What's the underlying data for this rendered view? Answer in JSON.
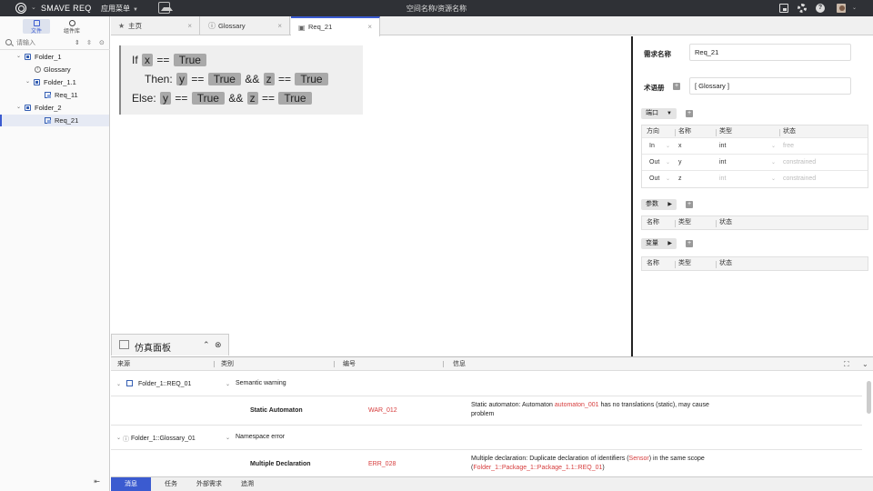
{
  "topbar": {
    "brand": "SMAVE REQ",
    "menu_label": "应用菜单",
    "workspace_path": "空间名称/资源名称"
  },
  "sidebar": {
    "tabs": [
      {
        "label": "文件",
        "active": true
      },
      {
        "label": "组件库",
        "active": false
      }
    ],
    "search_placeholder": "请输入",
    "tree": [
      {
        "label": "Folder_1",
        "type": "folder",
        "expanded": true
      },
      {
        "label": "Glossary",
        "type": "glossary"
      },
      {
        "label": "Folder_1.1",
        "type": "folder",
        "expanded": true
      },
      {
        "label": "Req_11",
        "type": "requirement"
      },
      {
        "label": "Folder_2",
        "type": "folder",
        "expanded": true
      },
      {
        "label": "Req_21",
        "type": "requirement",
        "selected": true
      }
    ],
    "footer_icon": "collapse-icon"
  },
  "tabs": [
    {
      "label": "主页",
      "icon": "star-icon",
      "active": false
    },
    {
      "label": "Glossary",
      "icon": "info-icon",
      "active": false
    },
    {
      "label": "Req_21",
      "icon": "requirement-icon",
      "active": true
    }
  ],
  "editor": {
    "line1": {
      "kw": "If",
      "var": "x",
      "op": "==",
      "val": "True"
    },
    "line2": {
      "kw": "Then:",
      "var1": "y",
      "op1": "==",
      "val1": "True",
      "and": "&&",
      "var2": "z",
      "op2": "==",
      "val2": "True"
    },
    "line3": {
      "kw": "Else:",
      "var1": "y",
      "op1": "==",
      "val1": "True",
      "and": "&&",
      "var2": "z",
      "op2": "==",
      "val2": "True"
    }
  },
  "props": {
    "name_label": "需求名称",
    "name_value": "Req_21",
    "glossary_label": "术语册",
    "glossary_value": "[ Glossary ]",
    "ports_btn": "端口",
    "ports_headers": [
      "方向",
      "名称",
      "类型",
      "状态"
    ],
    "ports_rows": [
      {
        "dir": "In",
        "name": "x",
        "type": "int",
        "status": "free"
      },
      {
        "dir": "Out",
        "name": "y",
        "type": "int",
        "status": "constrained"
      },
      {
        "dir": "Out",
        "name": "z",
        "type": "int",
        "status": "constrained"
      }
    ],
    "params_btn": "参数",
    "params_headers": [
      "名称",
      "类型",
      "状态"
    ],
    "vars_btn": "变量",
    "vars_headers": [
      "名称",
      "类型",
      "状态"
    ]
  },
  "sim_panel": {
    "title": "仿真面板"
  },
  "messages": {
    "headers": [
      "来源",
      "类别",
      "编号",
      "信息"
    ],
    "groups": [
      {
        "source": "Folder_1::REQ_01",
        "category": "Semantic warning",
        "item_category": "Static Automaton",
        "code": "WAR_012",
        "msg_a": "Static automaton: Automaton ",
        "msg_hl": "automaton_001",
        "msg_b": " has no translations (static), may cause",
        "msg_c": "problem"
      },
      {
        "source": "Folder_1::Glossary_01",
        "category": "Namespace error",
        "item_category": "Multiple Declaration",
        "code": "ERR_028",
        "msg_a": "Multiple declaration: Duplicate declaration of identifiers (",
        "msg_hl": "Sensor",
        "msg_b": ") in the same scope",
        "msg_c1": "(",
        "msg_hl2": "Folder_1::Package_1::Package_1.1::REQ_01",
        "msg_c2": ")"
      }
    ]
  },
  "bottom_tabs": [
    {
      "label": "消息",
      "active": true
    },
    {
      "label": "任务",
      "active": false
    },
    {
      "label": "外部需求",
      "active": false
    },
    {
      "label": "追溯",
      "active": false
    }
  ]
}
